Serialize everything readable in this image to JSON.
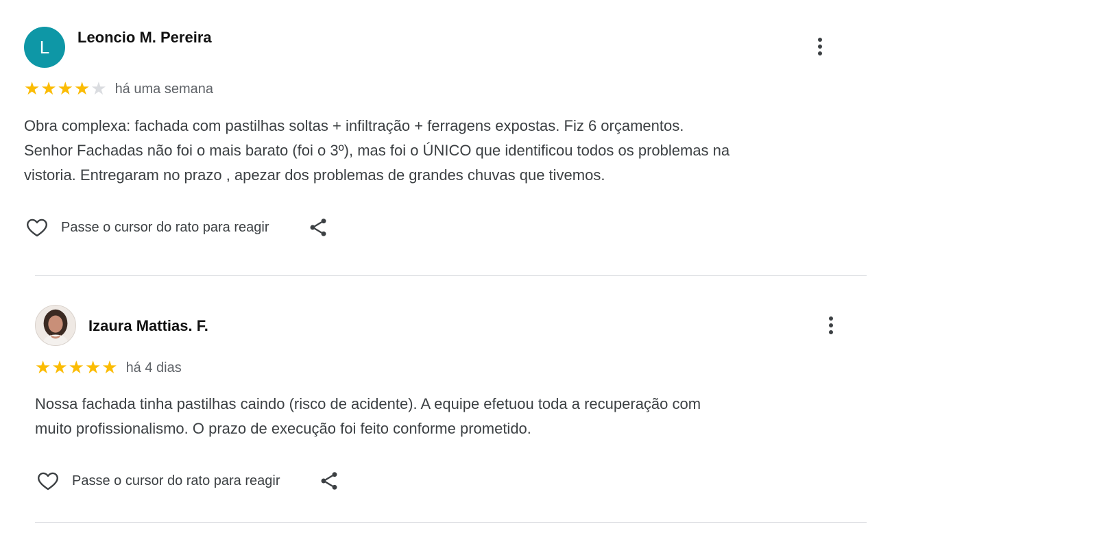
{
  "reviews": [
    {
      "author": "Leoncio M. Pereira",
      "avatar_letter": "L",
      "avatar_color": "#0e97a6",
      "rating": 4,
      "time": "há uma semana",
      "text": "Obra complexa: fachada com pastilhas soltas + infiltração + ferragens expostas. Fiz 6 orçamentos.\nSenhor Fachadas não foi o mais barato (foi o 3º), mas foi o ÚNICO que identificou todos os problemas na\nvistoria. Entregaram no prazo , apezar dos problemas de grandes chuvas que tivemos.",
      "react_label": "Passe o cursor do rato para reagir"
    },
    {
      "author": "Izaura Mattias. F.",
      "avatar_type": "photo",
      "rating": 5,
      "time": "há 4 dias",
      "text": "Nossa fachada tinha pastilhas caindo (risco de acidente). A equipe efetuou toda a recuperação com\nmuito profissionalismo. O prazo de execução foi feito conforme prometido.",
      "react_label": "Passe o cursor do rato para reagir"
    }
  ],
  "colors": {
    "star_on": "#fbbc04",
    "star_off": "#dadce0",
    "divider": "#dadce0"
  },
  "icons": [
    "more-vert-icon",
    "heart-outline-icon",
    "share-icon",
    "star-icon"
  ]
}
